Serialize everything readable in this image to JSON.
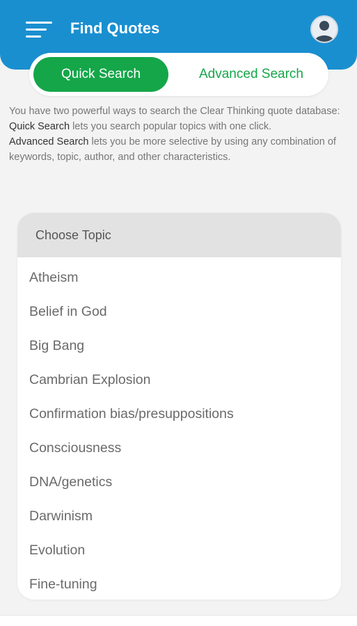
{
  "header": {
    "title": "Find Quotes"
  },
  "tabs": [
    {
      "label": "Quick Search",
      "active": true
    },
    {
      "label": "Advanced Search",
      "active": false
    }
  ],
  "intro": {
    "line1": "You have two powerful ways to search the Clear Thinking quote database:",
    "quick_bold": "Quick Search",
    "quick_rest": " lets you search popular topics with one click.",
    "advanced_bold": "Advanced Search",
    "advanced_rest": " lets you be more selective by using any combination of keywords, topic, author, and other characteristics."
  },
  "topics": {
    "header": "Choose Topic",
    "items": [
      "Atheism",
      "Belief in God",
      "Big Bang",
      "Cambrian Explosion",
      "Confirmation bias/presuppositions",
      "Consciousness",
      "DNA/genetics",
      "Darwinism",
      "Evolution",
      "Fine-tuning"
    ]
  },
  "colors": {
    "header_blue": "#1a8fd0",
    "accent_green": "#15a649"
  },
  "icons": {
    "menu": "hamburger-menu-icon",
    "profile": "user-avatar-icon"
  }
}
